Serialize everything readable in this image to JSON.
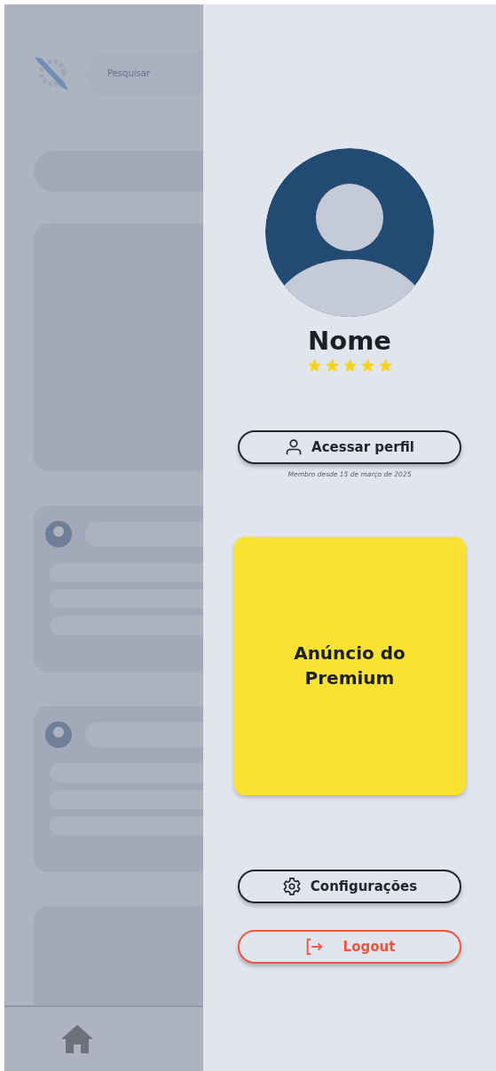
{
  "background": {
    "search": {
      "placeholder": "Pesquisar"
    }
  },
  "drawer": {
    "profile": {
      "name": "Nome",
      "stars": 5
    },
    "profile_button": {
      "label": "Acessar perfil"
    },
    "member_since": "Membro desde 15 de março de 2025",
    "ad": {
      "title": "Anúncio do Premium"
    },
    "actions": [
      {
        "kind": "settings",
        "label": "Configurações"
      },
      {
        "kind": "logout",
        "label": "Logout"
      }
    ]
  }
}
